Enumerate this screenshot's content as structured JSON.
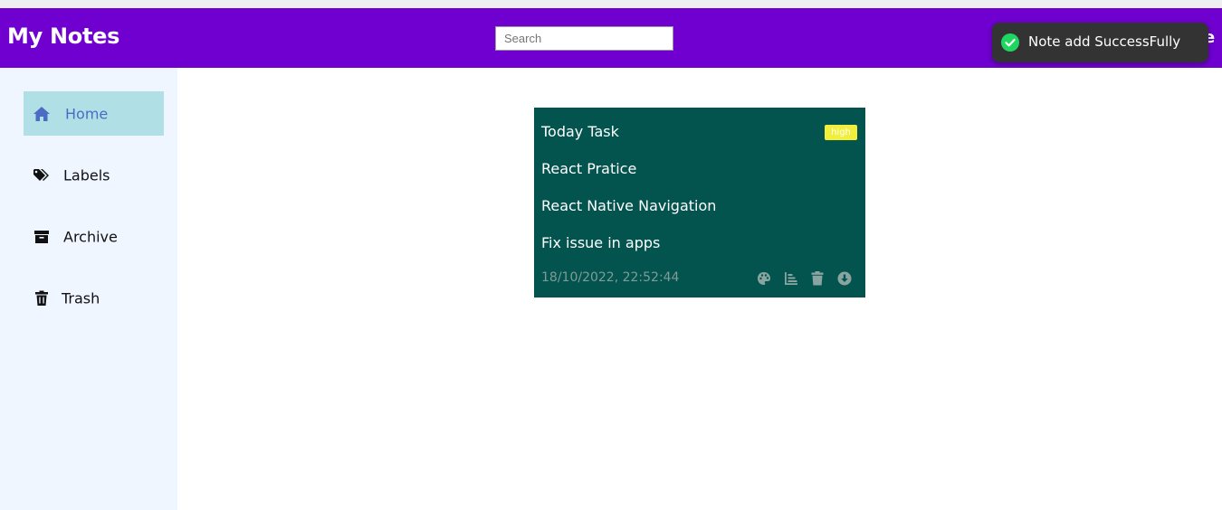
{
  "header": {
    "app_title": "My Notes",
    "search_placeholder": "Search",
    "search_value": "",
    "edge_glyph": "e",
    "color": "#6f00cf"
  },
  "sidebar": {
    "items": [
      {
        "label": "Home",
        "icon": "home-icon",
        "active": true
      },
      {
        "label": "Labels",
        "icon": "tag-icon",
        "active": false
      },
      {
        "label": "Archive",
        "icon": "archive-icon",
        "active": false
      },
      {
        "label": "Trash",
        "icon": "trash-icon",
        "active": false
      }
    ],
    "active_color": "#b0e0e6"
  },
  "note": {
    "title": "Today Task",
    "priority": "high",
    "lines": [
      "React Pratice",
      "React Native Navigation",
      "Fix issue in apps"
    ],
    "date": "18/10/2022, 22:52:44",
    "background": "#03534f",
    "actions": [
      "palette-icon",
      "chart-icon",
      "trash-icon",
      "download-icon"
    ]
  },
  "toast": {
    "message": "Note add SuccessFully",
    "icon": "check-circle-icon",
    "icon_color": "#1ed760"
  }
}
